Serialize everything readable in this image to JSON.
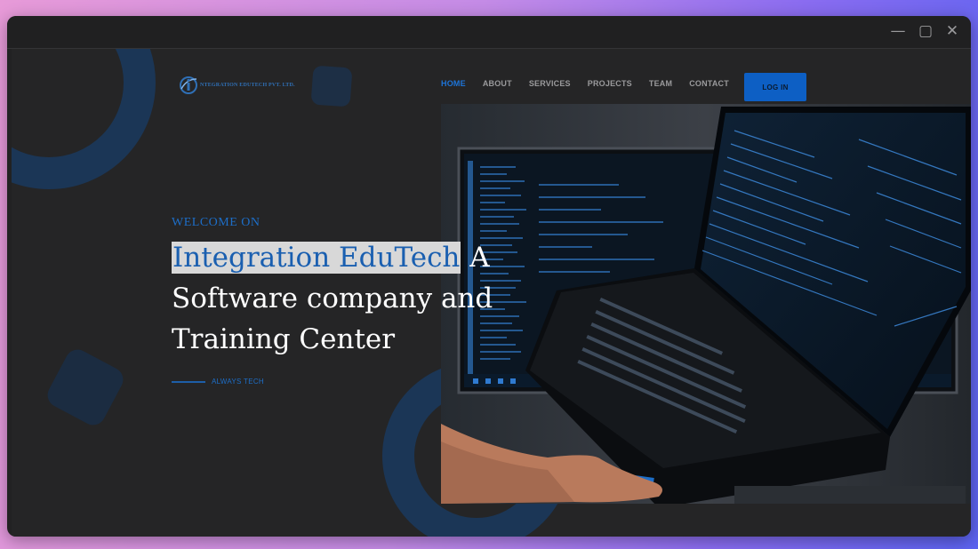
{
  "window": {
    "controls": {
      "minimize": "—",
      "maximize": "▢",
      "close": "✕"
    }
  },
  "header": {
    "logo_text": "NTEGRATION EDUTECH PVT. LTD.",
    "nav": [
      "HOME",
      "ABOUT",
      "SERVICES",
      "PROJECTS",
      "TEAM",
      "CONTACT"
    ],
    "active_nav": "HOME",
    "login_label": "LOG IN"
  },
  "hero": {
    "welcome": "WELCOME ON",
    "headline_highlight": "Integration EduTech",
    "headline_rest": " A Software company and Training Center",
    "tagline": "ALWAYS TECH",
    "image": "laptop-photo"
  },
  "colors": {
    "accent": "#1d74d8",
    "button": "#0d5fc4",
    "page_bg": "#252526",
    "deco": "#1b3656"
  }
}
